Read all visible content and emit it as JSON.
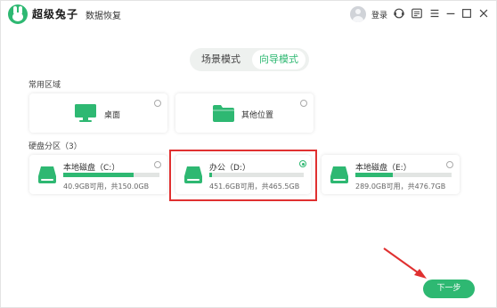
{
  "titlebar": {
    "brand": "超级兔子",
    "product": "数据恢复",
    "login": "登录",
    "icons": [
      "avatar-icon",
      "support-icon",
      "wechat-icon",
      "menu-icon",
      "minimize-icon",
      "maximize-icon",
      "close-icon"
    ]
  },
  "modes": {
    "scene": "场景模式",
    "guide": "向导模式",
    "active": "guide"
  },
  "common_area": {
    "title": "常用区域",
    "items": [
      {
        "label": "桌面",
        "icon": "monitor-icon",
        "selected": false
      },
      {
        "label": "其他位置",
        "icon": "folder-icon",
        "selected": false
      }
    ]
  },
  "partitions": {
    "title": "硬盘分区（3）",
    "drives": [
      {
        "name": "本地磁盘（C:）",
        "info": "40.9GB可用，共150.0GB",
        "used_fraction": 0.73,
        "selected": false
      },
      {
        "name": "办公（D:）",
        "info": "451.6GB可用，共465.5GB",
        "used_fraction": 0.03,
        "selected": true
      },
      {
        "name": "本地磁盘（E:）",
        "info": "289.0GB可用，共476.7GB",
        "used_fraction": 0.39,
        "selected": false
      }
    ]
  },
  "actions": {
    "next": "下一步"
  },
  "colors": {
    "accent": "#2eb872",
    "highlight": "#e03030"
  }
}
